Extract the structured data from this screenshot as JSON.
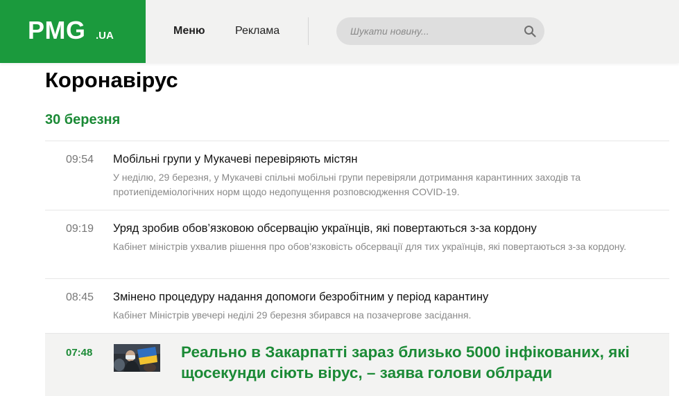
{
  "header": {
    "logo_main": "PMG",
    "logo_suffix": ".UA",
    "nav": {
      "menu": "Меню",
      "ads": "Реклама"
    },
    "search": {
      "placeholder": "Шукати новину...",
      "value": ""
    }
  },
  "page": {
    "title": "Коронавірус",
    "date": "30 березня"
  },
  "news": [
    {
      "time": "09:54",
      "title": "Мобільні групи у Мукачеві перевіряють містян",
      "lead": "У неділю, 29 березня, у Мукачеві спільні мобільні групи перевіряли дотримання карантинних заходів та протиепідеміологічних норм щодо недопущення розповсюдження COVID-19."
    },
    {
      "time": "09:19",
      "title": "Уряд зробив обов’язковою обсервацію українців, які повертаються з-за кордону",
      "lead": "Кабінет міністрів ухвалив рішення про обов’язковість обсервації для тих українців, які повертаються з-за кордону."
    },
    {
      "time": "08:45",
      "title": "Змінено процедуру надання допомоги безробітним у період карантину",
      "lead": "Кабінет Міністрів увечері неділі 29 березня збирався на позачергове засідання."
    },
    {
      "time": "07:48",
      "title": "Реально в Закарпатті зараз близько 5000 інфікованих, які щосекунди сіють вірус, – заява голови облради",
      "featured": true
    }
  ],
  "colors": {
    "brand_green": "#1b9a3d",
    "accent_green": "#1b8a36",
    "header_bg": "#f2f2f1"
  }
}
